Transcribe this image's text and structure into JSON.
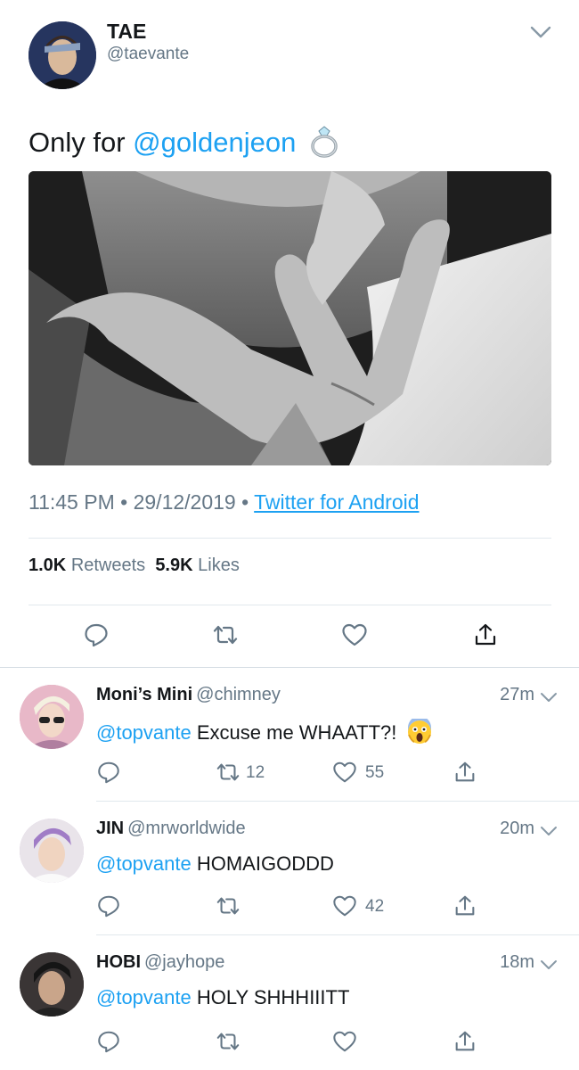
{
  "main_tweet": {
    "display_name": "TAE",
    "handle": "@taevante",
    "text_prefix": "Only for ",
    "mention": "@goldenjeon",
    "emoji": "ring",
    "time": "11:45 PM",
    "separator": "•",
    "date": "29/12/2019",
    "source": "Twitter for Android",
    "retweets_count": "1.0K",
    "retweets_label": "Retweets",
    "likes_count": "5.9K",
    "likes_label": "Likes",
    "actions": [
      "reply-icon",
      "retweet-icon",
      "like-icon",
      "share-icon"
    ]
  },
  "replies": [
    {
      "display_name": "Moni’s Mini",
      "handle": "@chimney",
      "time": "27m",
      "mention": "@topvante",
      "text": "Excuse me WHAATT?!",
      "emoji": "screaming-face",
      "retweets": "12",
      "likes": "55"
    },
    {
      "display_name": "JIN",
      "handle": "@mrworldwide",
      "time": "20m",
      "mention": "@topvante",
      "text": "HOMAIGODDD",
      "retweets": "",
      "likes": "42"
    },
    {
      "display_name": "HOBI",
      "handle": "@jayhope",
      "time": "18m",
      "mention": "@topvante",
      "text": "HOLY SHHHIIITT",
      "retweets": "",
      "likes": ""
    }
  ],
  "colors": {
    "accent": "#1da1f2",
    "secondary_text": "#657786",
    "primary_text": "#14171a",
    "divider": "#e1e8ed"
  }
}
